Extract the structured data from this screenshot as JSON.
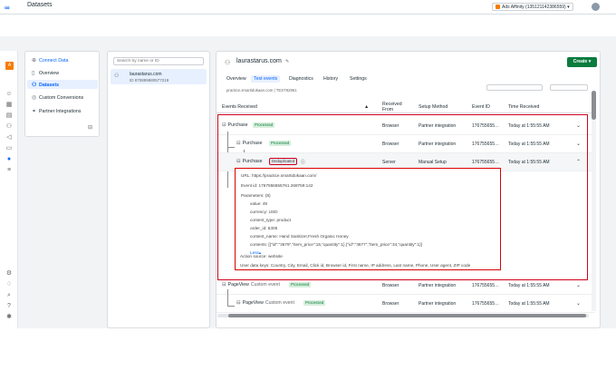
{
  "topbar": {
    "breadcrumb": "Datasets",
    "account": "Ads Affinity (135121142386559)"
  },
  "sidebar": {
    "items": [
      {
        "label": "Connect Data",
        "icon": "plus-circle-icon"
      },
      {
        "label": "Overview",
        "icon": "document-icon"
      },
      {
        "label": "Datasets",
        "icon": "people-icon"
      },
      {
        "label": "Custom Conversions",
        "icon": "target-icon"
      },
      {
        "label": "Partner Integrations",
        "icon": "handshake-icon"
      }
    ]
  },
  "datasets": {
    "search_placeholder": "Search by name or ID",
    "items": [
      {
        "name": "laurastarus.com",
        "id": "ID 870899880577219"
      }
    ]
  },
  "main": {
    "title": "laurastarus.com",
    "create_label": "Create",
    "tabs": [
      "Overview",
      "Test events",
      "Diagnostics",
      "History",
      "Settings"
    ],
    "active_tab": "Test events",
    "domain_line": "practice.smartidokaan.com  |  TEST92961",
    "columns": [
      "Events Received",
      "Received From",
      "Setup Method",
      "Event ID",
      "Time Received"
    ],
    "rows": [
      {
        "event": "Purchase",
        "badge": "Processed",
        "from": "Browser",
        "method": "Partner integration",
        "event_id": "176755655…",
        "time": "Today at 1:55:55 AM"
      },
      {
        "event": "Purchase",
        "badge": "Processed",
        "from": "Browser",
        "method": "Partner integration",
        "event_id": "176755655…",
        "time": "Today at 1:55:55 AM"
      },
      {
        "event": "Purchase",
        "badge": "Deduplicated",
        "from": "Server",
        "method": "Manual Setup",
        "event_id": "176755655…",
        "time": "Today at 1:55:55 AM"
      },
      {
        "event": "PageView",
        "custom": "Custom event",
        "badge": "Processed",
        "from": "Browser",
        "method": "Partner integration",
        "event_id": "176755655…",
        "time": "Today at 1:55:55 AM"
      },
      {
        "event": "PageView",
        "custom": "Custom event",
        "badge": "Processed",
        "from": "Browser",
        "method": "Partner integration",
        "event_id": "176755655…",
        "time": "Today at 1:55:55 AM"
      }
    ],
    "detail": {
      "url": "URL: https://practice.smartidokaan.com/",
      "event_id": "Event id: 1767556555761.268759:142",
      "parameters": "Parameters: (8)",
      "value": "value:  49",
      "currency": "currency:  USD",
      "content_type": "content_type:  product",
      "order_id": "order_id:  5305",
      "content_name": "content_name:  Hand Sanitizer,Fresh Organic Honey",
      "contents": "contents:  [{\"id\":\"3679\",\"item_price\":15,\"quantity\":1},{\"id\":\"3677\",\"item_price\":34,\"quantity\":1}]",
      "less": "Less",
      "action_source": "Action source: website",
      "user_data": "User data keys: Country, City, Email, Click id, Browser id, First name, IP address, Last name, Phone, User agent, ZIP code"
    }
  }
}
